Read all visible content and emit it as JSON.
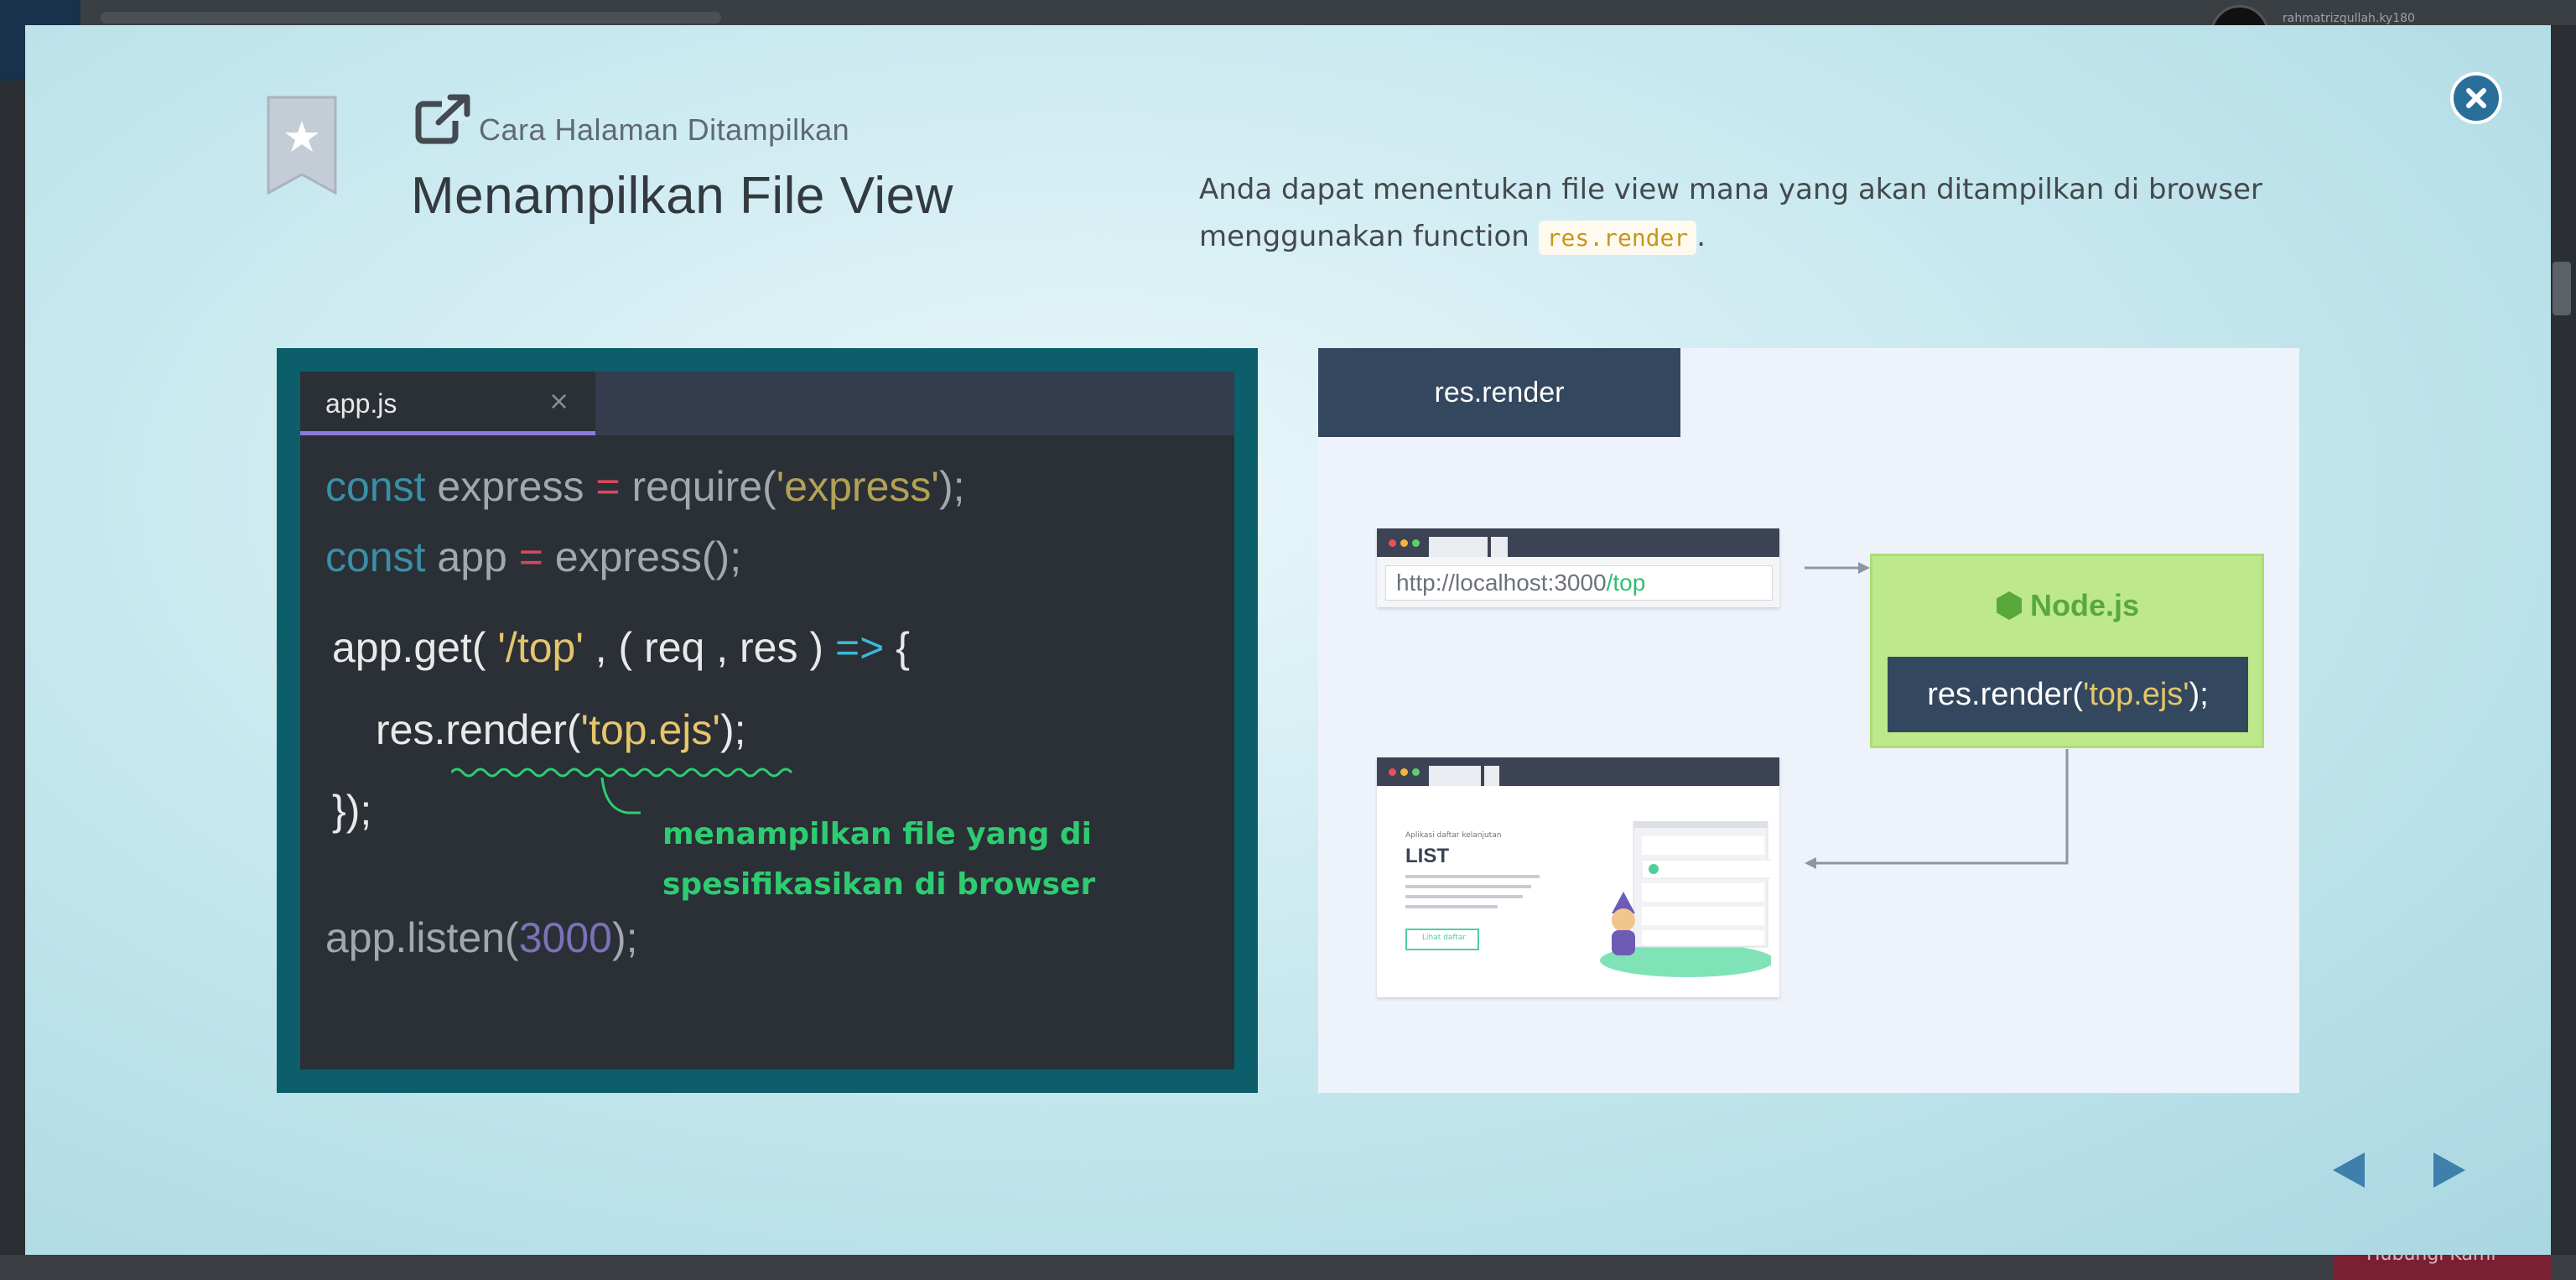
{
  "background": {
    "user_name": "rahmatrizqullah.ky180",
    "bottom_button_label": "Hubungi Kami"
  },
  "modal": {
    "subtitle": "Cara Halaman Ditampilkan",
    "title": "Menampilkan File View",
    "description_prefix": "Anda dapat menentukan file view mana yang akan ditampilkan di browser menggunakan function ",
    "description_code": "res.render",
    "description_suffix": ".",
    "close_icon": "close-icon",
    "prev_icon": "triangle-left-icon",
    "next_icon": "triangle-right-icon"
  },
  "editor": {
    "tab_name": "app.js",
    "tab_close": "×",
    "code": {
      "l1_kw": "const",
      "l1_name": " express ",
      "l1_op": "=",
      "l1_call": " require(",
      "l1_str": "'express'",
      "l1_end": ");",
      "l2_kw": "const",
      "l2_name": " app ",
      "l2_op": "=",
      "l2_end": " express();",
      "l3_start": "app.get( ",
      "l3_str": "'/top'",
      "l3_mid": " , ( req , res ) ",
      "l3_arrow": "=>",
      "l3_end": " {",
      "l4_start": "res.render(",
      "l4_str": "'top.ejs'",
      "l4_end": ");",
      "l5": "});",
      "l6_start": "app.listen(",
      "l6_num": "3000",
      "l6_end": ");"
    },
    "annotation_line1": "menampilkan file yang di",
    "annotation_line2": "spesifikasikan di browser"
  },
  "diagram": {
    "tab_label": "res.render",
    "url_base": "http://localhost:3000",
    "url_path": "/top",
    "node_title": "Node.js",
    "node_code_start": "res.render(",
    "node_code_str": "'top.ejs'",
    "node_code_end": ");",
    "list_caption": "Aplikasi daftar kelanjutan",
    "list_title": "LIST",
    "list_button": "Lihat daftar"
  },
  "colors": {
    "accent": "#2a6f9a",
    "green": "#2ecc71",
    "editor_bg": "#2b2f36",
    "frame": "#0c5e6b"
  }
}
